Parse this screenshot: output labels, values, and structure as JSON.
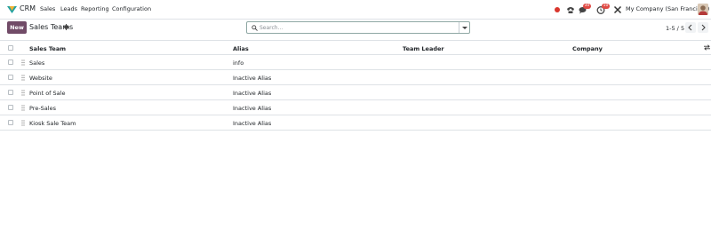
{
  "navbar": {
    "app_name": "CRM",
    "menu": [
      "Sales",
      "Leads",
      "Reporting",
      "Configuration"
    ],
    "activity_badge": "30",
    "messages_badge": "10",
    "company": "My Company (San Francisco)"
  },
  "control_panel": {
    "new_label": "New",
    "breadcrumb": "Sales Teams",
    "search_placeholder": "Search...",
    "pager": "1-5 / 5"
  },
  "table": {
    "columns": [
      "Sales Team",
      "Alias",
      "Team Leader",
      "Company"
    ],
    "rows": [
      {
        "name": "Sales",
        "alias": "info"
      },
      {
        "name": "Website",
        "alias": "Inactive Alias"
      },
      {
        "name": "Point of Sale",
        "alias": "Inactive Alias"
      },
      {
        "name": "Pre-Sales",
        "alias": "Inactive Alias"
      },
      {
        "name": "Kiosk Sale Team",
        "alias": "Inactive Alias"
      }
    ]
  },
  "colors": {
    "brand": "#714b67",
    "badge": "#e04a44",
    "record_dot": "#d9362d"
  },
  "icons": {
    "app_logo": "crm-logo-icon",
    "settings": "gear-icon",
    "search": "search-icon",
    "phone": "phone-icon",
    "chat": "chat-icon",
    "activity": "clock-icon",
    "tools": "tools-icon"
  }
}
